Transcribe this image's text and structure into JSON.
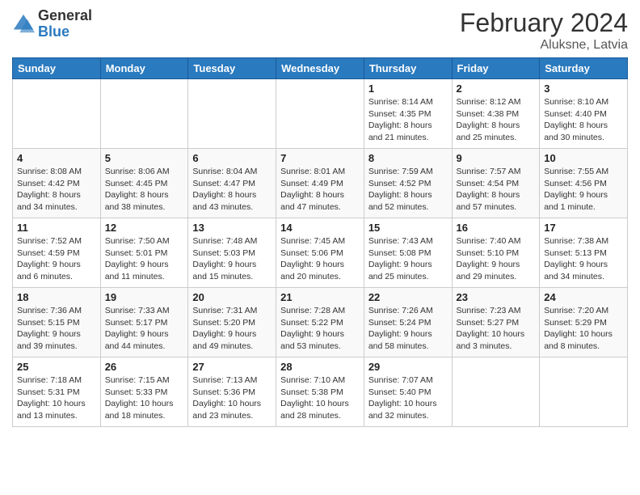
{
  "logo": {
    "general": "General",
    "blue": "Blue"
  },
  "header": {
    "month": "February 2024",
    "location": "Aluksne, Latvia"
  },
  "weekdays": [
    "Sunday",
    "Monday",
    "Tuesday",
    "Wednesday",
    "Thursday",
    "Friday",
    "Saturday"
  ],
  "weeks": [
    [
      {
        "day": "",
        "info": ""
      },
      {
        "day": "",
        "info": ""
      },
      {
        "day": "",
        "info": ""
      },
      {
        "day": "",
        "info": ""
      },
      {
        "day": "1",
        "info": "Sunrise: 8:14 AM\nSunset: 4:35 PM\nDaylight: 8 hours\nand 21 minutes."
      },
      {
        "day": "2",
        "info": "Sunrise: 8:12 AM\nSunset: 4:38 PM\nDaylight: 8 hours\nand 25 minutes."
      },
      {
        "day": "3",
        "info": "Sunrise: 8:10 AM\nSunset: 4:40 PM\nDaylight: 8 hours\nand 30 minutes."
      }
    ],
    [
      {
        "day": "4",
        "info": "Sunrise: 8:08 AM\nSunset: 4:42 PM\nDaylight: 8 hours\nand 34 minutes."
      },
      {
        "day": "5",
        "info": "Sunrise: 8:06 AM\nSunset: 4:45 PM\nDaylight: 8 hours\nand 38 minutes."
      },
      {
        "day": "6",
        "info": "Sunrise: 8:04 AM\nSunset: 4:47 PM\nDaylight: 8 hours\nand 43 minutes."
      },
      {
        "day": "7",
        "info": "Sunrise: 8:01 AM\nSunset: 4:49 PM\nDaylight: 8 hours\nand 47 minutes."
      },
      {
        "day": "8",
        "info": "Sunrise: 7:59 AM\nSunset: 4:52 PM\nDaylight: 8 hours\nand 52 minutes."
      },
      {
        "day": "9",
        "info": "Sunrise: 7:57 AM\nSunset: 4:54 PM\nDaylight: 8 hours\nand 57 minutes."
      },
      {
        "day": "10",
        "info": "Sunrise: 7:55 AM\nSunset: 4:56 PM\nDaylight: 9 hours\nand 1 minute."
      }
    ],
    [
      {
        "day": "11",
        "info": "Sunrise: 7:52 AM\nSunset: 4:59 PM\nDaylight: 9 hours\nand 6 minutes."
      },
      {
        "day": "12",
        "info": "Sunrise: 7:50 AM\nSunset: 5:01 PM\nDaylight: 9 hours\nand 11 minutes."
      },
      {
        "day": "13",
        "info": "Sunrise: 7:48 AM\nSunset: 5:03 PM\nDaylight: 9 hours\nand 15 minutes."
      },
      {
        "day": "14",
        "info": "Sunrise: 7:45 AM\nSunset: 5:06 PM\nDaylight: 9 hours\nand 20 minutes."
      },
      {
        "day": "15",
        "info": "Sunrise: 7:43 AM\nSunset: 5:08 PM\nDaylight: 9 hours\nand 25 minutes."
      },
      {
        "day": "16",
        "info": "Sunrise: 7:40 AM\nSunset: 5:10 PM\nDaylight: 9 hours\nand 29 minutes."
      },
      {
        "day": "17",
        "info": "Sunrise: 7:38 AM\nSunset: 5:13 PM\nDaylight: 9 hours\nand 34 minutes."
      }
    ],
    [
      {
        "day": "18",
        "info": "Sunrise: 7:36 AM\nSunset: 5:15 PM\nDaylight: 9 hours\nand 39 minutes."
      },
      {
        "day": "19",
        "info": "Sunrise: 7:33 AM\nSunset: 5:17 PM\nDaylight: 9 hours\nand 44 minutes."
      },
      {
        "day": "20",
        "info": "Sunrise: 7:31 AM\nSunset: 5:20 PM\nDaylight: 9 hours\nand 49 minutes."
      },
      {
        "day": "21",
        "info": "Sunrise: 7:28 AM\nSunset: 5:22 PM\nDaylight: 9 hours\nand 53 minutes."
      },
      {
        "day": "22",
        "info": "Sunrise: 7:26 AM\nSunset: 5:24 PM\nDaylight: 9 hours\nand 58 minutes."
      },
      {
        "day": "23",
        "info": "Sunrise: 7:23 AM\nSunset: 5:27 PM\nDaylight: 10 hours\nand 3 minutes."
      },
      {
        "day": "24",
        "info": "Sunrise: 7:20 AM\nSunset: 5:29 PM\nDaylight: 10 hours\nand 8 minutes."
      }
    ],
    [
      {
        "day": "25",
        "info": "Sunrise: 7:18 AM\nSunset: 5:31 PM\nDaylight: 10 hours\nand 13 minutes."
      },
      {
        "day": "26",
        "info": "Sunrise: 7:15 AM\nSunset: 5:33 PM\nDaylight: 10 hours\nand 18 minutes."
      },
      {
        "day": "27",
        "info": "Sunrise: 7:13 AM\nSunset: 5:36 PM\nDaylight: 10 hours\nand 23 minutes."
      },
      {
        "day": "28",
        "info": "Sunrise: 7:10 AM\nSunset: 5:38 PM\nDaylight: 10 hours\nand 28 minutes."
      },
      {
        "day": "29",
        "info": "Sunrise: 7:07 AM\nSunset: 5:40 PM\nDaylight: 10 hours\nand 32 minutes."
      },
      {
        "day": "",
        "info": ""
      },
      {
        "day": "",
        "info": ""
      }
    ]
  ]
}
